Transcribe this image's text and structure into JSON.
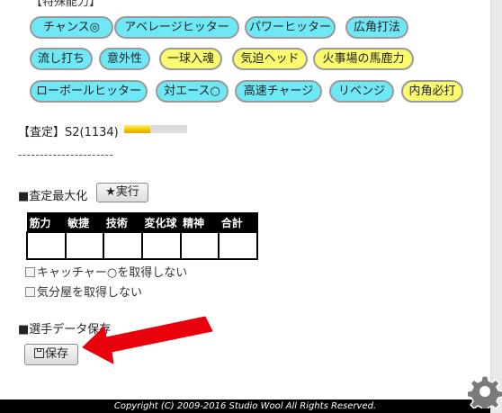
{
  "section_heading": "【特殊能力】",
  "abilities": [
    {
      "label": "チャンス◎",
      "color": "blue"
    },
    {
      "label": "アベレージヒッター",
      "color": "blue"
    },
    {
      "label": "パワーヒッター",
      "color": "blue"
    },
    {
      "label": "広角打法",
      "color": "blue"
    },
    {
      "label": "流し打ち",
      "color": "blue"
    },
    {
      "label": "意外性",
      "color": "blue"
    },
    {
      "label": "一球入魂",
      "color": "yellow"
    },
    {
      "label": "気迫ヘッド",
      "color": "yellow"
    },
    {
      "label": "火事場の馬鹿力",
      "color": "yellow"
    },
    {
      "label": "ローボールヒッター",
      "color": "blue"
    },
    {
      "label": "対エース○",
      "color": "blue"
    },
    {
      "label": "高速チャージ",
      "color": "blue"
    },
    {
      "label": "リベンジ",
      "color": "blue"
    },
    {
      "label": "内角必打",
      "color": "yellow"
    }
  ],
  "colors": {
    "blue": "#6fe8f6",
    "yellow": "#fafb6e"
  },
  "assessment": {
    "text": "【査定】S2(1134)",
    "bar_fraction": 0.42
  },
  "divider": "----------------------",
  "maximize": {
    "label": "■査定最大化",
    "button": "★実行"
  },
  "table": {
    "headers": [
      "筋力",
      "敏捷",
      "技術",
      "変化球",
      "精神",
      "合計"
    ],
    "row": [
      "",
      "",
      "",
      "",
      "",
      ""
    ]
  },
  "options": [
    "キャッチャー○を取得しない",
    "気分屋を取得しない"
  ],
  "save": {
    "label": "■選手データ保存",
    "button": "保存",
    "icon": "floppy-disk-icon"
  },
  "footer": "Copyright (C) 2009-2016 Studio Wool All Rights Reserved.",
  "corner_icon": "gear-icon",
  "annotation": "red-arrow"
}
